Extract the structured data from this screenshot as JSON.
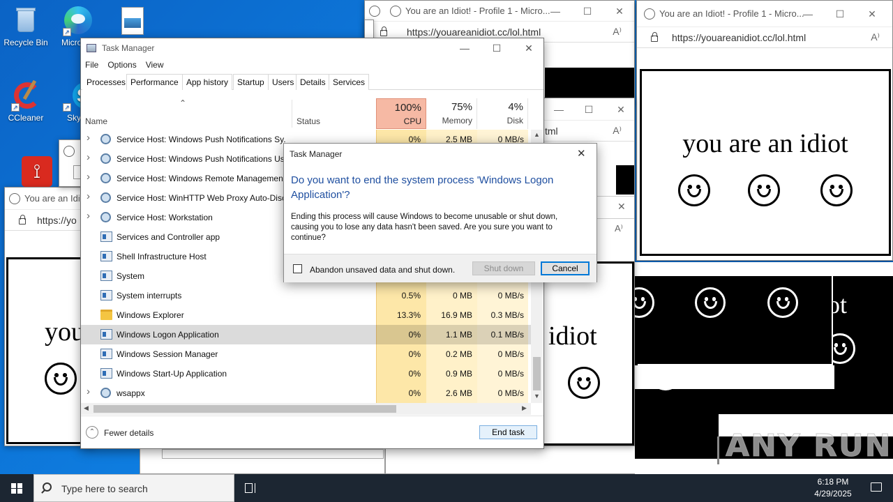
{
  "desktop": {
    "icons": [
      {
        "label": "Recycle Bin"
      },
      {
        "label": "Microsoft Edge"
      },
      {
        "label": "CCleaner"
      },
      {
        "label": "Skype"
      },
      {
        "label": "Acrobat"
      }
    ]
  },
  "browser": {
    "title_full": "You are an Idiot! - Profile 1 - Micro...",
    "title_short": "You are an Idiot!",
    "title_stub": "Y",
    "url": "https://youareanidiot.cc/lol.html",
    "url_short": "https://yo",
    "url_tail": "tml",
    "page_text": "you are an idiot",
    "page_text_partial_left": "you",
    "page_text_partial_right": "idiot",
    "page_text_partial_fragment": "ot"
  },
  "task_manager": {
    "title": "Task Manager",
    "menu": [
      "File",
      "Options",
      "View"
    ],
    "tabs": [
      "Processes",
      "Performance",
      "App history",
      "Startup",
      "Users",
      "Details",
      "Services"
    ],
    "columns": {
      "name": "Name",
      "status": "Status",
      "cpu_pct": "100%",
      "cpu": "CPU",
      "mem_pct": "75%",
      "mem": "Memory",
      "disk_pct": "4%",
      "disk": "Disk"
    },
    "rows": [
      {
        "name": "Service Host: Windows Push Notifications Sy...",
        "cpu": "0%",
        "mem": "2.5 MB",
        "disk": "0 MB/s",
        "expand": true,
        "icon": "gear"
      },
      {
        "name": "Service Host: Windows Push Notifications Us...",
        "cpu": "",
        "mem": "",
        "disk": "",
        "expand": true,
        "icon": "gear"
      },
      {
        "name": "Service Host: Windows Remote Managemen...",
        "cpu": "",
        "mem": "",
        "disk": "",
        "expand": true,
        "icon": "gear"
      },
      {
        "name": "Service Host: WinHTTP Web Proxy Auto-Disc...",
        "cpu": "",
        "mem": "",
        "disk": "",
        "expand": true,
        "icon": "gear"
      },
      {
        "name": "Service Host: Workstation",
        "cpu": "",
        "mem": "",
        "disk": "",
        "expand": true,
        "icon": "gear"
      },
      {
        "name": "Services and Controller app",
        "cpu": "",
        "mem": "",
        "disk": "",
        "expand": false,
        "icon": "app"
      },
      {
        "name": "Shell Infrastructure Host",
        "cpu": "",
        "mem": "",
        "disk": "",
        "expand": false,
        "icon": "app"
      },
      {
        "name": "System",
        "cpu": "",
        "mem": "",
        "disk": "",
        "expand": false,
        "icon": "app"
      },
      {
        "name": "System interrupts",
        "cpu": "0.5%",
        "mem": "0 MB",
        "disk": "0 MB/s",
        "expand": false,
        "icon": "app"
      },
      {
        "name": "Windows Explorer",
        "cpu": "13.3%",
        "mem": "16.9 MB",
        "disk": "0.3 MB/s",
        "expand": false,
        "icon": "folder"
      },
      {
        "name": "Windows Logon Application",
        "cpu": "0%",
        "mem": "1.1 MB",
        "disk": "0.1 MB/s",
        "expand": false,
        "icon": "app",
        "selected": true
      },
      {
        "name": "Windows Session Manager",
        "cpu": "0%",
        "mem": "0.2 MB",
        "disk": "0 MB/s",
        "expand": false,
        "icon": "app"
      },
      {
        "name": "Windows Start-Up Application",
        "cpu": "0%",
        "mem": "0.9 MB",
        "disk": "0 MB/s",
        "expand": false,
        "icon": "app"
      },
      {
        "name": "wsappx",
        "cpu": "0%",
        "mem": "2.6 MB",
        "disk": "0 MB/s",
        "expand": true,
        "icon": "gear"
      }
    ],
    "fewer_details": "Fewer details",
    "end_task": "End task"
  },
  "dialog": {
    "title": "Task Manager",
    "heading": "Do you want to end the system process 'Windows Logon Application'?",
    "body": "Ending this process will cause Windows to become unusable or shut down, causing you to lose any data hasn't been saved. Are you sure you want to continue?",
    "checkbox_label": "Abandon unsaved data and shut down.",
    "checkbox_checked": false,
    "shutdown_label": "Shut down",
    "cancel_label": "Cancel"
  },
  "taskbar": {
    "search_placeholder": "Type here to search",
    "time": "6:18 PM",
    "date": "4/29/2025"
  },
  "watermark": {
    "text": "ANY RUN"
  }
}
